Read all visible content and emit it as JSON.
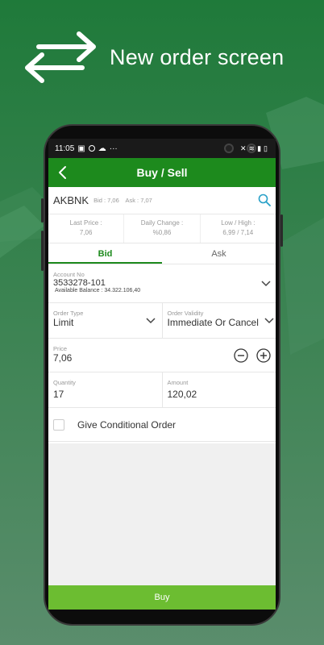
{
  "promo": {
    "title": "New order screen"
  },
  "status_bar": {
    "time": "11:05"
  },
  "app_bar": {
    "title": "Buy / Sell"
  },
  "stock": {
    "symbol": "AKBNK",
    "bid": "Bid : 7,06",
    "ask": "Ask : 7,07"
  },
  "stats": [
    {
      "label": "Last Price :",
      "value": "7,06"
    },
    {
      "label": "Daily Change :",
      "value": "%0,86"
    },
    {
      "label": "Low / High :",
      "value": "6,99 / 7,14"
    }
  ],
  "tabs": [
    {
      "label": "Bid"
    },
    {
      "label": "Ask"
    }
  ],
  "account": {
    "label": "Account No",
    "value": "3533278-101",
    "balance": "Available Balance : 34.322.106,40"
  },
  "order_type": {
    "label": "Order Type",
    "value": "Limit"
  },
  "order_validity": {
    "label": "Order Validity",
    "value": "Immediate Or Cancel"
  },
  "price": {
    "label": "Price",
    "value": "7,06"
  },
  "quantity": {
    "label": "Quantity",
    "value": "17"
  },
  "amount": {
    "label": "Amount",
    "value": "120,02"
  },
  "conditional": {
    "label": "Give Conditional Order",
    "checked": false
  },
  "buy_button": {
    "label": "Buy"
  },
  "colors": {
    "appbar": "#1d8a1d",
    "buy_button": "#6cbd31",
    "background": "#2e7a45",
    "search_icon": "#27a0c8"
  }
}
